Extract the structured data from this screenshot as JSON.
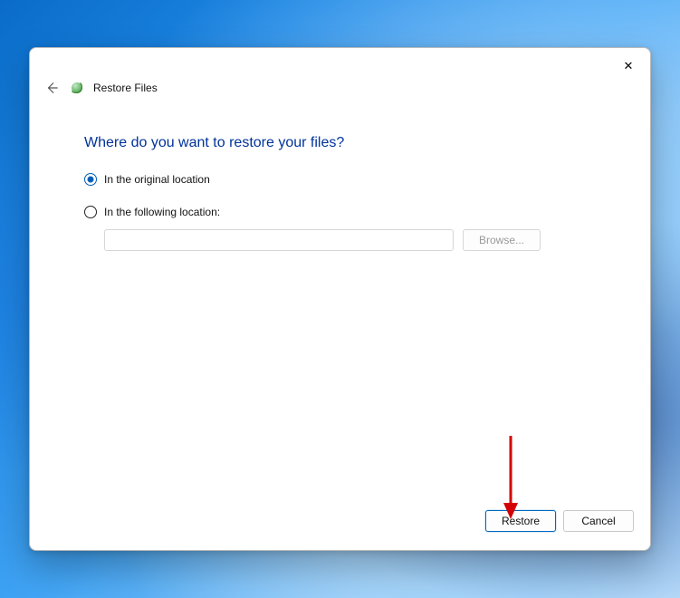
{
  "window": {
    "title": "Restore Files"
  },
  "content": {
    "heading": "Where do you want to restore your files?",
    "options": {
      "original": {
        "label": "In the original location",
        "checked": true
      },
      "custom": {
        "label": "In the following location:",
        "checked": false
      }
    },
    "path_value": "",
    "browse_label": "Browse..."
  },
  "footer": {
    "primary_label": "Restore",
    "cancel_label": "Cancel"
  },
  "colors": {
    "accent": "#005fb8",
    "heading": "#003399"
  }
}
